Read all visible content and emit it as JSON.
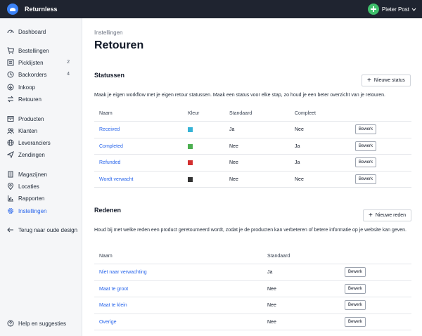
{
  "app": {
    "name": "Returnless",
    "user_name": "Pieter Post"
  },
  "sidebar": {
    "items": [
      {
        "label": "Dashboard",
        "icon": "dashboard-icon"
      },
      {
        "label": "Bestellingen",
        "icon": "cart-icon"
      },
      {
        "label": "Picklijsten",
        "icon": "list-icon",
        "count": "2"
      },
      {
        "label": "Backorders",
        "icon": "clock-icon",
        "count": "4"
      },
      {
        "label": "Inkoop",
        "icon": "download-icon"
      },
      {
        "label": "Retouren",
        "icon": "return-icon"
      },
      {
        "label": "Producten",
        "icon": "box-icon"
      },
      {
        "label": "Klanten",
        "icon": "users-icon"
      },
      {
        "label": "Leveranciers",
        "icon": "globe-icon"
      },
      {
        "label": "Zendingen",
        "icon": "send-icon"
      },
      {
        "label": "Magazijnen",
        "icon": "building-icon"
      },
      {
        "label": "Locaties",
        "icon": "location-pin-icon"
      },
      {
        "label": "Rapporten",
        "icon": "chart-icon"
      },
      {
        "label": "Instellingen",
        "icon": "gear-icon"
      },
      {
        "label": "Terug naar oude design",
        "icon": "arrow-left-icon"
      }
    ],
    "help": "Help en suggesties"
  },
  "page": {
    "breadcrumb": "Instellingen",
    "title": "Retouren"
  },
  "statussen": {
    "heading": "Statussen",
    "new_button": "Nieuwe status",
    "description": "Maak je eigen workflow met je eigen retour statussen. Maak een status voor elke stap, zo houd je een beter overzicht van je retouren.",
    "columns": [
      "Naam",
      "Kleur",
      "Standaard",
      "Compleet"
    ],
    "rows": [
      {
        "name": "Received",
        "color": "#36b3d6",
        "standaard": "Ja",
        "compleet": "Nee",
        "action": "Bewerk"
      },
      {
        "name": "Completed",
        "color": "#4caf50",
        "standaard": "Nee",
        "compleet": "Ja",
        "action": "Bewerk"
      },
      {
        "name": "Refunded",
        "color": "#d32f2f",
        "standaard": "Nee",
        "compleet": "Ja",
        "action": "Bewerk"
      },
      {
        "name": "Wordt verwacht",
        "color": "#333333",
        "standaard": "Nee",
        "compleet": "Nee",
        "action": "Bewerk"
      }
    ]
  },
  "redenen": {
    "heading": "Redenen",
    "new_button": "Nieuwe reden",
    "description": "Houd bij met welke reden een product geretourneerd wordt, zodat je de producten kan verbeteren of betere informatie op je website kan geven.",
    "columns": [
      "Naam",
      "Standaard"
    ],
    "rows": [
      {
        "name": "Niet naar verwachting",
        "standaard": "Ja",
        "action": "Bewerk"
      },
      {
        "name": "Maat te groot",
        "standaard": "Nee",
        "action": "Bewerk"
      },
      {
        "name": "Maat te klein",
        "standaard": "Nee",
        "action": "Bewerk"
      },
      {
        "name": "Overige",
        "standaard": "Nee",
        "action": "Bewerk"
      }
    ]
  },
  "colors": {
    "topbar": "#1f2430",
    "accent": "#2563eb",
    "sidebar_bg": "#f5f6f8"
  }
}
